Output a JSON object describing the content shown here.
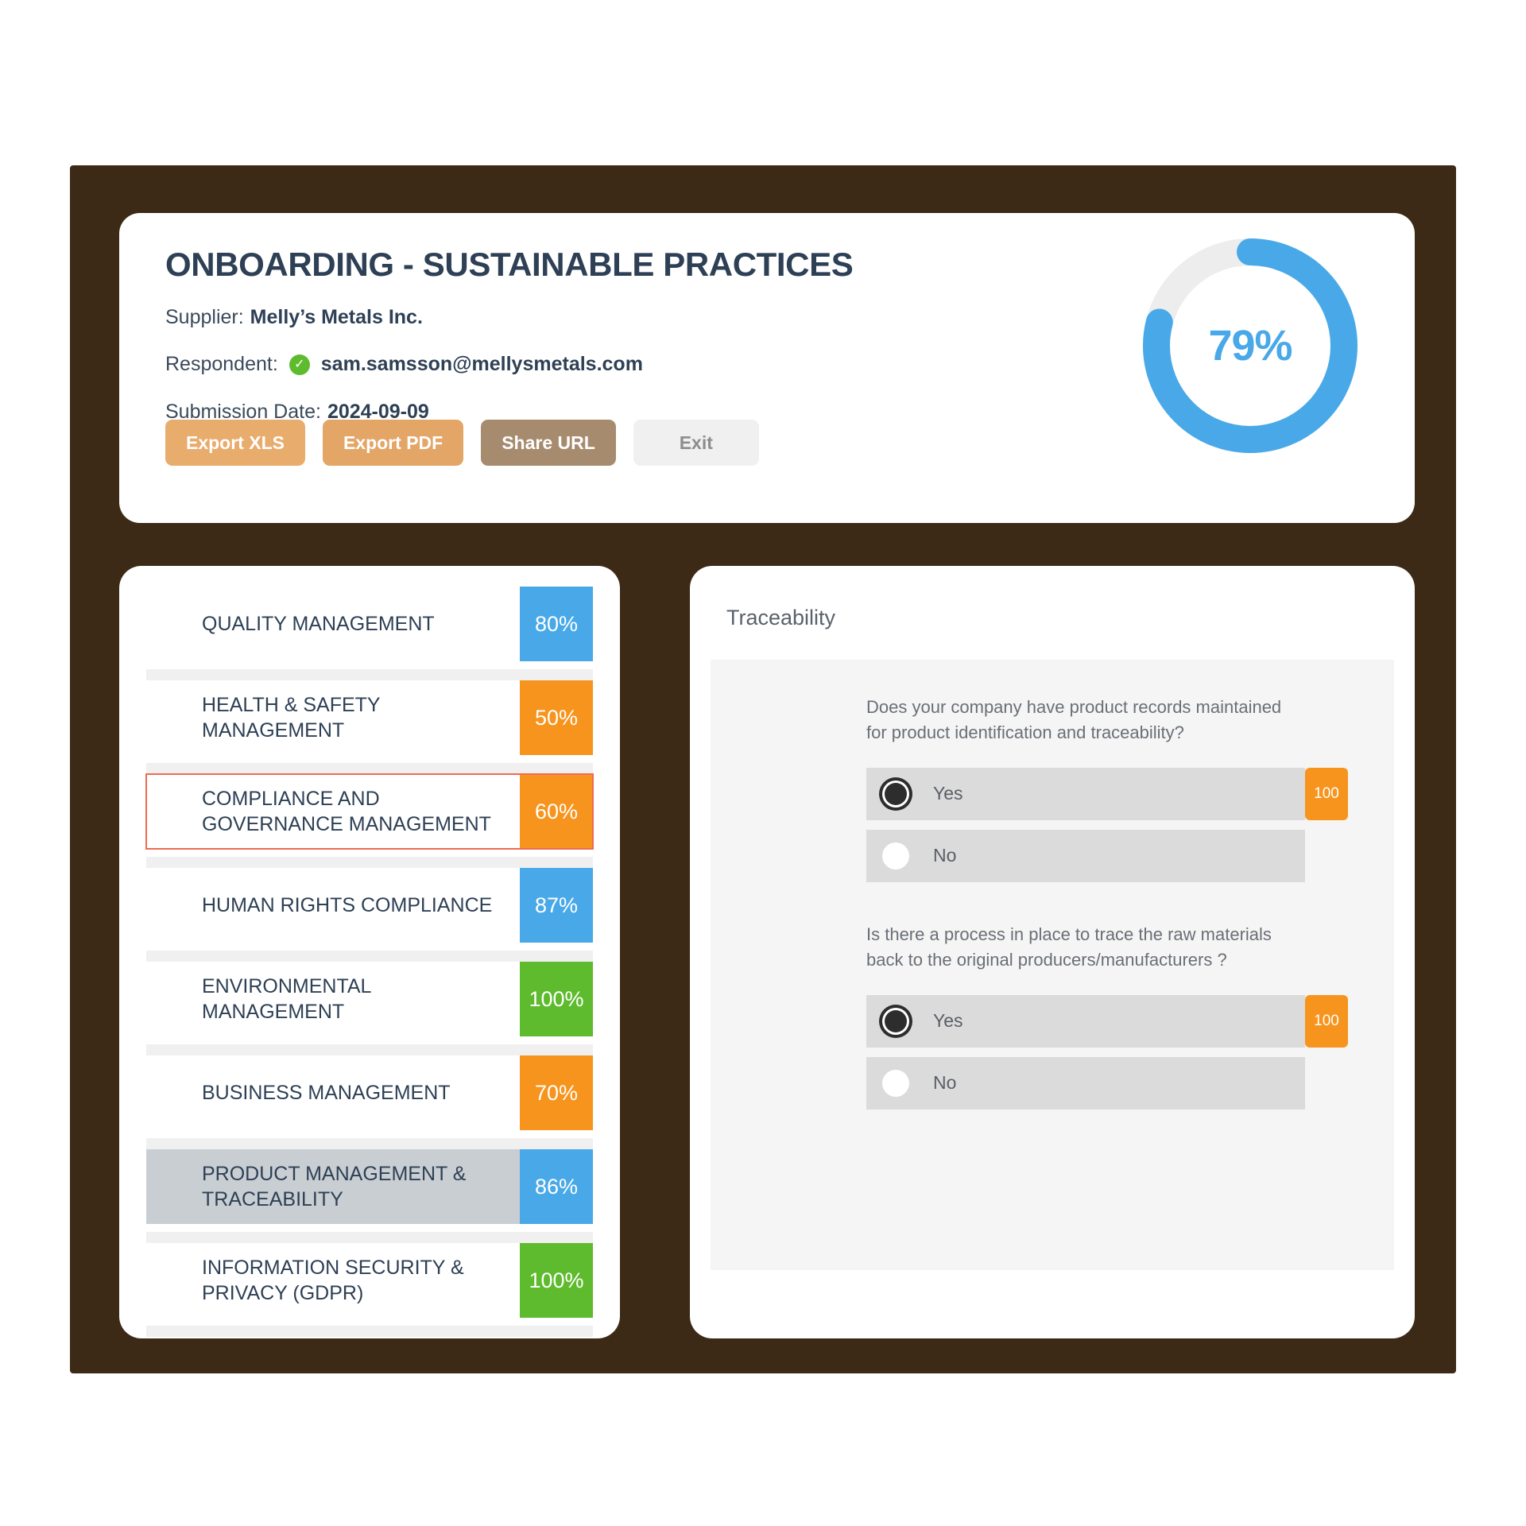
{
  "header": {
    "title": "ONBOARDING - SUSTAINABLE PRACTICES",
    "supplier_label": "Supplier:",
    "supplier_value": "Melly’s Metals Inc.",
    "respondent_label": "Respondent:",
    "respondent_value": "sam.samsson@mellysmetals.com",
    "verified_icon": "✓",
    "submission_label": "Submission Date:",
    "submission_value": "2024-09-09",
    "buttons": {
      "export_xls": "Export XLS",
      "export_pdf": "Export PDF",
      "share_url": "Share URL",
      "exit": "Exit"
    },
    "gauge": {
      "value": 79,
      "label": "79%",
      "track_color": "#EDEDED",
      "progress_color": "#49A9E8"
    }
  },
  "categories": [
    {
      "label": "QUALITY MANAGEMENT",
      "score": "80%",
      "color": "#49A9E8",
      "state": "normal"
    },
    {
      "label": "HEALTH & SAFETY MANAGEMENT",
      "score": "50%",
      "color": "#F7941D",
      "state": "normal"
    },
    {
      "label": "COMPLIANCE AND GOVERNANCE MANAGEMENT",
      "score": "60%",
      "color": "#F7941D",
      "state": "outlined"
    },
    {
      "label": "HUMAN RIGHTS COMPLIANCE",
      "score": "87%",
      "color": "#49A9E8",
      "state": "normal"
    },
    {
      "label": "ENVIRONMENTAL MANAGEMENT",
      "score": "100%",
      "color": "#5FBB2E",
      "state": "normal"
    },
    {
      "label": "BUSINESS MANAGEMENT",
      "score": "70%",
      "color": "#F7941D",
      "state": "normal"
    },
    {
      "label": "PRODUCT MANAGEMENT & TRACEABILITY",
      "score": "86%",
      "color": "#49A9E8",
      "state": "selected"
    },
    {
      "label": "INFORMATION SECURITY & PRIVACY (GDPR)",
      "score": "100%",
      "color": "#5FBB2E",
      "state": "normal"
    }
  ],
  "detail": {
    "section_title": "Traceability",
    "questions": [
      {
        "text": "Does your company have product records maintained for product identification and traceability?",
        "options": [
          {
            "label": "Yes",
            "selected": true,
            "score": "100"
          },
          {
            "label": "No",
            "selected": false,
            "score": ""
          }
        ]
      },
      {
        "text": "Is there a process in place to trace the raw materials back to the original producers/manufacturers ?",
        "options": [
          {
            "label": "Yes",
            "selected": true,
            "score": "100"
          },
          {
            "label": "No",
            "selected": false,
            "score": ""
          }
        ]
      }
    ]
  },
  "theme": {
    "backdrop": "#3C2A17",
    "card": "#ffffff",
    "title_color": "#2E4055",
    "blue": "#49A9E8",
    "orange": "#F7941D",
    "green": "#5FBB2E",
    "outline_red": "#EE6B52",
    "selected_row": "#C9CED3"
  }
}
